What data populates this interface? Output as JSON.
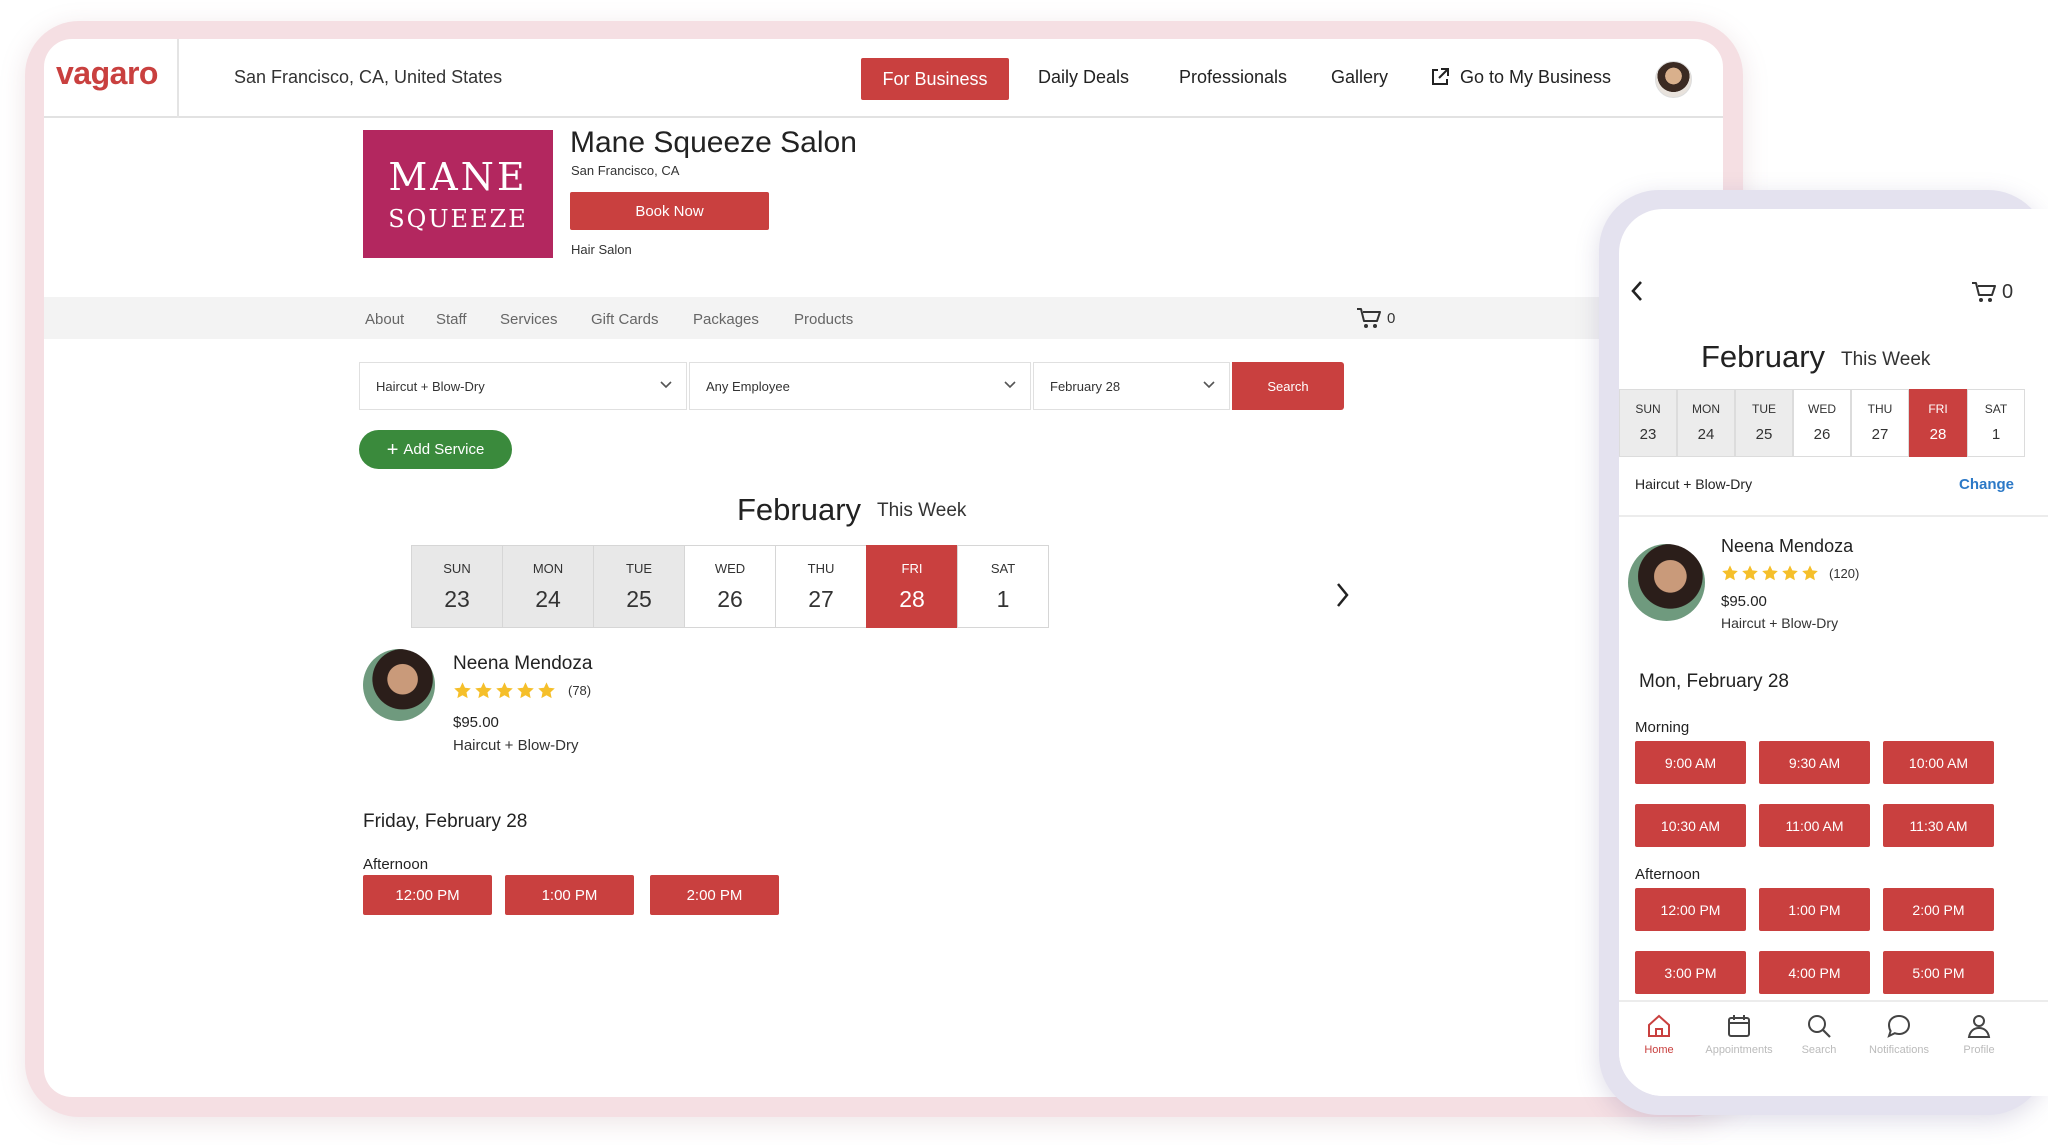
{
  "nav": {
    "logo": "vagaro",
    "location": "San Francisco, CA, United States",
    "for_business": "For Business",
    "daily_deals": "Daily Deals",
    "professionals": "Professionals",
    "gallery": "Gallery",
    "go_to_business": "Go to My Business"
  },
  "salon": {
    "logo_line1": "MANE",
    "logo_line2": "SQUEEZE",
    "name": "Mane Squeeze Salon",
    "city": "San Francisco, CA",
    "book_now": "Book Now",
    "type": "Hair Salon"
  },
  "subnav": {
    "items": [
      "About",
      "Staff",
      "Services",
      "Gift Cards",
      "Packages",
      "Products"
    ],
    "cart_count": "0"
  },
  "search": {
    "service": "Haircut + Blow-Dry",
    "employee": "Any Employee",
    "date": "February 28",
    "button": "Search",
    "add_service": "Add Service"
  },
  "calendar": {
    "month": "February",
    "week_label": "This Week",
    "days": [
      {
        "name": "SUN",
        "date": "23",
        "state": "past"
      },
      {
        "name": "MON",
        "date": "24",
        "state": "past"
      },
      {
        "name": "TUE",
        "date": "25",
        "state": "past"
      },
      {
        "name": "WED",
        "date": "26",
        "state": "open"
      },
      {
        "name": "THU",
        "date": "27",
        "state": "open"
      },
      {
        "name": "FRI",
        "date": "28",
        "state": "active"
      },
      {
        "name": "SAT",
        "date": "1",
        "state": "open"
      }
    ]
  },
  "stylist": {
    "name": "Neena Mendoza",
    "rating": 5,
    "reviews": "(78)",
    "price": "$95.00",
    "service": "Haircut + Blow-Dry"
  },
  "availability": {
    "date": "Friday, February 28",
    "afternoon_label": "Afternoon",
    "afternoon_slots": [
      "12:00 PM",
      "1:00 PM",
      "2:00 PM"
    ]
  },
  "phone": {
    "cart_count": "0",
    "month": "February",
    "week_label": "This Week",
    "days": [
      {
        "name": "SUN",
        "date": "23",
        "state": "past"
      },
      {
        "name": "MON",
        "date": "24",
        "state": "past"
      },
      {
        "name": "TUE",
        "date": "25",
        "state": "past"
      },
      {
        "name": "WED",
        "date": "26",
        "state": "open"
      },
      {
        "name": "THU",
        "date": "27",
        "state": "open"
      },
      {
        "name": "FRI",
        "date": "28",
        "state": "active"
      },
      {
        "name": "SAT",
        "date": "1",
        "state": "open"
      }
    ],
    "service": "Haircut + Blow-Dry",
    "change": "Change",
    "stylist": {
      "name": "Neena Mendoza",
      "rating": 5,
      "reviews": "(120)",
      "price": "$95.00",
      "service": "Haircut + Blow-Dry"
    },
    "date": "Mon, February 28",
    "morning_label": "Morning",
    "morning_slots": [
      "9:00 AM",
      "9:30 AM",
      "10:00 AM",
      "10:30 AM",
      "11:00 AM",
      "11:30 AM"
    ],
    "afternoon_label": "Afternoon",
    "afternoon_slots": [
      "12:00 PM",
      "1:00 PM",
      "2:00 PM",
      "3:00 PM",
      "4:00 PM",
      "5:00 PM"
    ],
    "tabs": [
      {
        "label": "Home",
        "icon": "home-icon",
        "active": true
      },
      {
        "label": "Appointments",
        "icon": "calendar-icon",
        "active": false
      },
      {
        "label": "Search",
        "icon": "search-icon",
        "active": false
      },
      {
        "label": "Notifications",
        "icon": "chat-bubble-icon",
        "active": false
      },
      {
        "label": "Profile",
        "icon": "profile-icon",
        "active": false
      }
    ]
  },
  "colors": {
    "accent": "#c9403f",
    "brand_logo_bg": "#b3275f",
    "add_service_green": "#3a8a3c",
    "link_blue": "#2c79c7",
    "star_gold": "#f5bf2a"
  }
}
